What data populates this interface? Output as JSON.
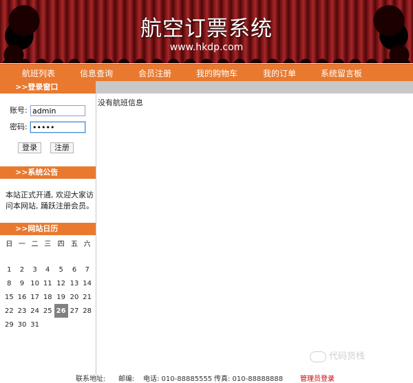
{
  "banner": {
    "title": "航空订票系统",
    "url": "www.hkdp.com"
  },
  "nav": [
    "航班列表",
    "信息查询",
    "会员注册",
    "我的购物车",
    "我的订单",
    "系统留言板"
  ],
  "login": {
    "heading": ">>登录窗口",
    "account_label": "账号:",
    "account_value": "admin",
    "password_label": "密码:",
    "password_value": "•••••",
    "login_button": "登录",
    "register_button": "注册"
  },
  "notice": {
    "heading": ">>系统公告",
    "text": "本站正式开通, 欢迎大家访问本网站, 踊跃注册会员。"
  },
  "calendar": {
    "heading": ">>网站日历",
    "weekdays": [
      "日",
      "一",
      "二",
      "三",
      "四",
      "五",
      "六"
    ],
    "weeks": [
      [
        "",
        "",
        "",
        "",
        "",
        "",
        ""
      ],
      [
        "1",
        "2",
        "3",
        "4",
        "5",
        "6",
        "7"
      ],
      [
        "8",
        "9",
        "10",
        "11",
        "12",
        "13",
        "14"
      ],
      [
        "15",
        "16",
        "17",
        "18",
        "19",
        "20",
        "21"
      ],
      [
        "22",
        "23",
        "24",
        "25",
        "26",
        "27",
        "28"
      ],
      [
        "29",
        "30",
        "31",
        "",
        "",
        "",
        ""
      ]
    ],
    "today": "26"
  },
  "main": {
    "message": "没有航班信息"
  },
  "footer": {
    "address_label": "联系地址:",
    "zip_label": "邮编:",
    "phone": "电话: 010-88885555",
    "fax": "传真: 010-88888888",
    "admin_link": "管理员登录"
  },
  "watermark": "代码货栈"
}
